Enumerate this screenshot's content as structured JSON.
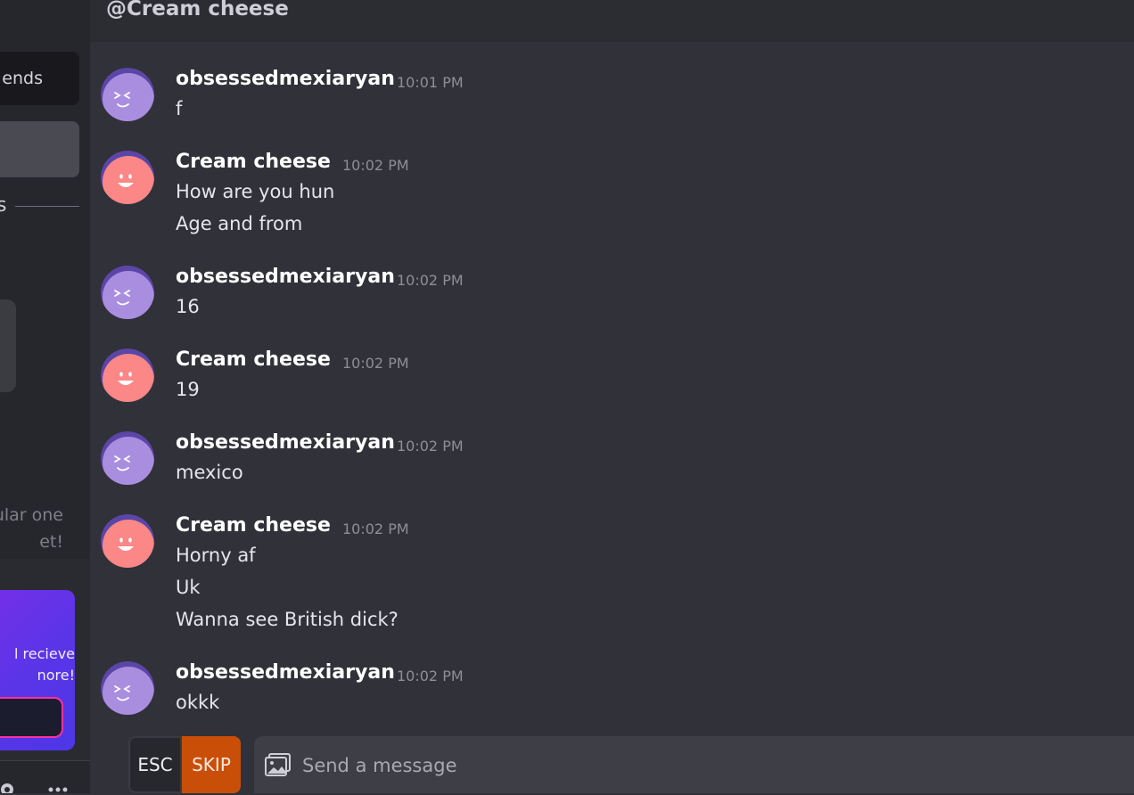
{
  "sidebar": {
    "friends_label": "ends",
    "section_letter": "s",
    "empty_text_line1": "ular one",
    "empty_text_line2": "et!",
    "promo_line1": "l recieve",
    "promo_line2": "nore!"
  },
  "chat": {
    "title": "@Cream cheese",
    "messages": [
      {
        "author": "obsessedmexiaryan",
        "time": "10:01 PM",
        "lines": [
          "f"
        ]
      },
      {
        "author": "Cream cheese",
        "time": "10:02 PM",
        "lines": [
          "How are you hun",
          "Age and from"
        ]
      },
      {
        "author": "obsessedmexiaryan",
        "time": "10:02 PM",
        "lines": [
          "16"
        ]
      },
      {
        "author": "Cream cheese",
        "time": "10:02 PM",
        "lines": [
          "19"
        ]
      },
      {
        "author": "obsessedmexiaryan",
        "time": "10:02 PM",
        "lines": [
          "mexico"
        ]
      },
      {
        "author": "Cream cheese",
        "time": "10:02 PM",
        "lines": [
          "Horny af",
          "Uk",
          "Wanna see British dick?"
        ]
      },
      {
        "author": "obsessedmexiaryan",
        "time": "10:02 PM",
        "lines": [
          "okkk"
        ]
      }
    ]
  },
  "input": {
    "esc_label": "ESC",
    "skip_label": "SKIP",
    "placeholder": "Send a message"
  },
  "colors": {
    "purple_avatar": "#a98ee0",
    "purple_ring": "#5b46a8",
    "pink_avatar": "#fb8787",
    "pink_ring": "#5b46a8",
    "skip": "#c94f09",
    "promo_border": "#ff2fa4"
  },
  "icons": {
    "image": "image-icon",
    "settings": "gear-icon",
    "more": "more-icon"
  }
}
